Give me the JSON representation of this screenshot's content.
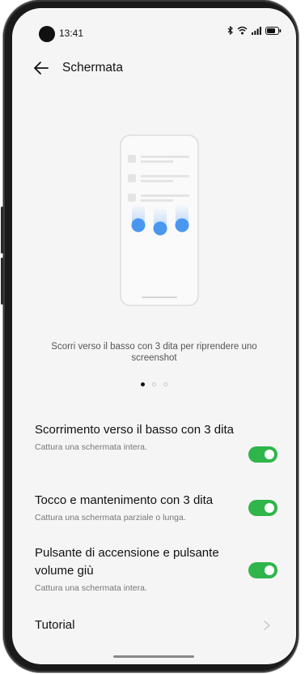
{
  "status_bar": {
    "time": "13:41"
  },
  "header": {
    "title": "Schermata"
  },
  "illustration": {
    "caption": "Scorri verso il basso con 3 dita per riprendere uno screenshot"
  },
  "pager": {
    "count": 3,
    "active_index": 0
  },
  "settings": [
    {
      "title": "Scorrimento verso il basso con 3 dita",
      "subtitle": "Cattura una schermata intera.",
      "enabled": true
    },
    {
      "title": "Tocco e mantenimento con 3 dita",
      "subtitle": "Cattura una schermata parziale o lunga.",
      "enabled": true
    },
    {
      "title": "Pulsante di accensione e pulsante volume giù",
      "subtitle": "Cattura una schermata intera.",
      "enabled": true
    }
  ],
  "tutorial": {
    "label": "Tutorial"
  },
  "colors": {
    "toggle_on": "#30b54b",
    "accent_blue": "#4a97ef",
    "background": "#f5f5f5"
  }
}
